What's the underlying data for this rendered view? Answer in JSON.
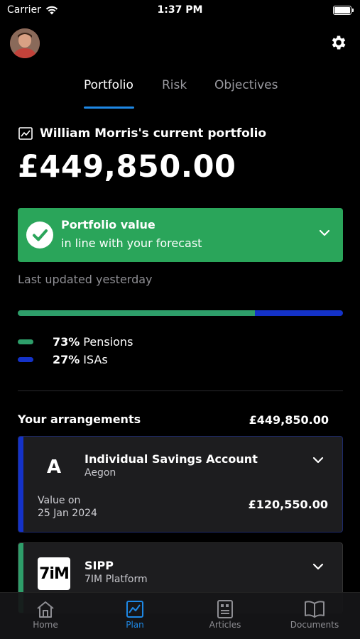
{
  "status_bar": {
    "carrier": "Carrier",
    "time": "1:37 PM"
  },
  "tabs": [
    {
      "label": "Portfolio",
      "active": true
    },
    {
      "label": "Risk",
      "active": false
    },
    {
      "label": "Objectives",
      "active": false
    }
  ],
  "portfolio": {
    "title": "William Morris's current portfolio",
    "value": "£449,850.00",
    "status_title": "Portfolio value",
    "status_subtitle": "in line with your forecast",
    "last_updated": "Last updated yesterday"
  },
  "allocation": [
    {
      "pct": "73%",
      "label": "Pensions",
      "fraction": 0.73,
      "color": "#2e9e6a"
    },
    {
      "pct": "27%",
      "label": "ISAs",
      "fraction": 0.27,
      "color": "#1432c8"
    }
  ],
  "arrangements": {
    "heading": "Your arrangements",
    "total": "£449,850.00",
    "items": [
      {
        "logo_text": "A",
        "name": "Individual Savings Account",
        "provider": "Aegon",
        "value_label_line1": "Value on",
        "value_label_line2": "25 Jan 2024",
        "value": "£120,550.00",
        "accent": "#1432c8"
      },
      {
        "logo_text": "7iM",
        "name": "SIPP",
        "provider": "7IM Platform",
        "accent": "#2e9e6a"
      }
    ]
  },
  "bottom_nav": [
    {
      "label": "Home",
      "icon": "home-icon",
      "active": false
    },
    {
      "label": "Plan",
      "icon": "chart-icon",
      "active": true
    },
    {
      "label": "Articles",
      "icon": "article-icon",
      "active": false
    },
    {
      "label": "Documents",
      "icon": "book-icon",
      "active": false
    }
  ],
  "colors": {
    "accent_blue": "#1e88e5",
    "success_green": "#2aa55a"
  }
}
